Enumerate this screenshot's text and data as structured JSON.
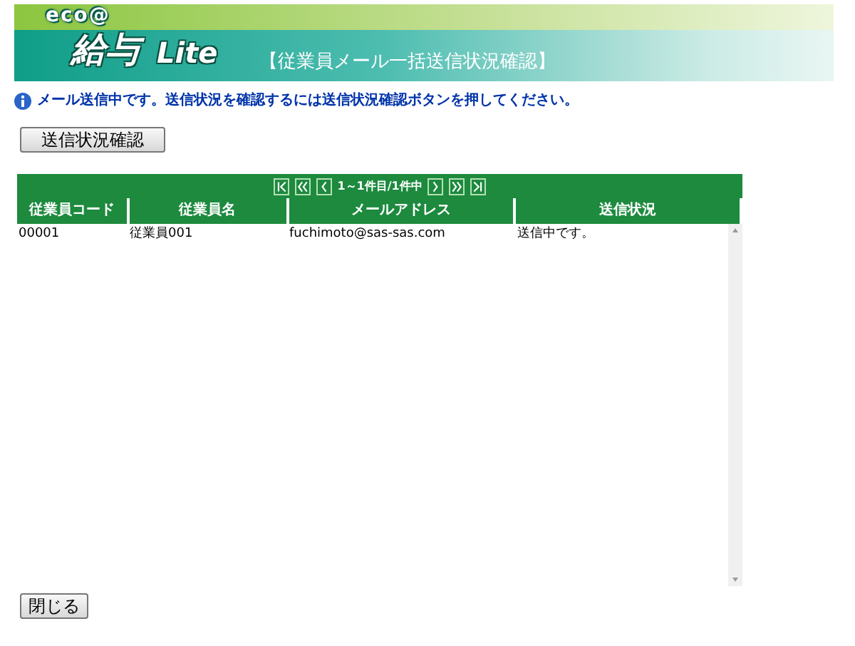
{
  "header": {
    "logo_top": "eco@",
    "logo_main": "給与",
    "logo_suffix": "Lite",
    "title": "【従業員メール一括送信状況確認】"
  },
  "message": "メール送信中です。送信状況を確認するには送信状況確認ボタンを押してください。",
  "check_button": "送信状況確認",
  "pager": {
    "range": "1～1件目/1件中"
  },
  "table": {
    "columns": [
      "従業員コード",
      "従業員名",
      "メールアドレス",
      "送信状況"
    ],
    "rows": [
      [
        "00001",
        "従業員001",
        "fuchimoto@sas-sas.com",
        "送信中です。"
      ]
    ]
  },
  "close_button": "閉じる"
}
